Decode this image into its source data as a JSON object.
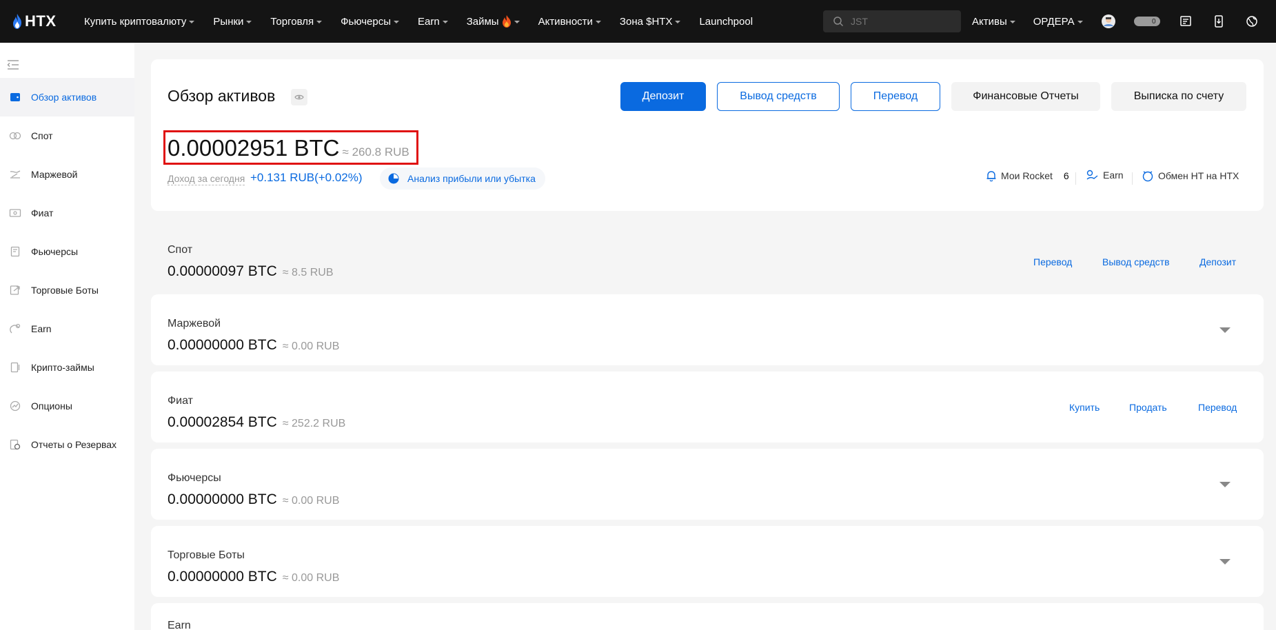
{
  "brand": {
    "name": "HTX"
  },
  "nav": {
    "items": [
      {
        "label": "Купить криптовалюту",
        "caret": true
      },
      {
        "label": "Рынки",
        "caret": true
      },
      {
        "label": "Торговля",
        "caret": true
      },
      {
        "label": "Фьючерсы",
        "caret": true
      },
      {
        "label": "Earn",
        "caret": true
      },
      {
        "label": "Займы",
        "caret": true,
        "fire": true
      },
      {
        "label": "Активности",
        "caret": true
      },
      {
        "label": "Зона $HTX",
        "caret": true
      },
      {
        "label": "Launchpool",
        "caret": false
      }
    ],
    "search_placeholder": "JST",
    "assets_label": "Активы",
    "orders_label": "ОРДЕРА",
    "badge_count": "0"
  },
  "sidebar": {
    "items": [
      {
        "label": "Обзор активов",
        "icon": "wallet-icon",
        "active": true
      },
      {
        "label": "Спот",
        "icon": "spot-icon"
      },
      {
        "label": "Маржевой",
        "icon": "margin-icon"
      },
      {
        "label": "Фиат",
        "icon": "fiat-icon"
      },
      {
        "label": "Фьючерсы",
        "icon": "futures-icon"
      },
      {
        "label": "Торговые Боты",
        "icon": "bots-icon"
      },
      {
        "label": "Earn",
        "icon": "earn-icon"
      },
      {
        "label": "Крипто-займы",
        "icon": "loans-icon"
      },
      {
        "label": "Опционы",
        "icon": "options-icon"
      },
      {
        "label": "Отчеты о Резервах",
        "icon": "reserves-icon"
      }
    ]
  },
  "overview": {
    "title": "Обзор активов",
    "buttons": {
      "deposit": "Депозит",
      "withdraw": "Вывод средств",
      "transfer": "Перевод",
      "reports": "Финансовые Отчеты",
      "statement": "Выписка по счету"
    },
    "balance": "0.00002951 BTC",
    "balance_approx": "≈ 260.8 RUB",
    "income_label": "Доход за сегодня",
    "income_value": "+0.131 RUB(+0.02%)",
    "analysis_label": "Анализ прибыли или убытка",
    "rocket_label": "Мои Rocket",
    "rocket_count": "6",
    "earn_label": "Earn",
    "exchange_label": "Обмен HT на HTX"
  },
  "accounts": [
    {
      "name": "Спот",
      "balance": "0.00000097 BTC",
      "approx": "≈ 8.5 RUB",
      "links": [
        "Перевод",
        "Вывод средств",
        "Депозит"
      ]
    },
    {
      "name": "Маржевой",
      "balance": "0.00000000 BTC",
      "approx": "≈ 0.00 RUB",
      "links": []
    },
    {
      "name": "Фиат",
      "balance": "0.00002854 BTC",
      "approx": "≈ 252.2 RUB",
      "links": [
        "Купить",
        "Продать",
        "Перевод"
      ]
    },
    {
      "name": "Фьючерсы",
      "balance": "0.00000000 BTC",
      "approx": "≈ 0.00 RUB",
      "links": []
    },
    {
      "name": "Торговые Боты",
      "balance": "0.00000000 BTC",
      "approx": "≈ 0.00 RUB",
      "links": []
    },
    {
      "name": "Earn",
      "balance": "",
      "approx": "",
      "links": []
    }
  ],
  "colors": {
    "accent": "#0a6ae0",
    "topbar": "#141414",
    "highlight": "#e01010"
  }
}
